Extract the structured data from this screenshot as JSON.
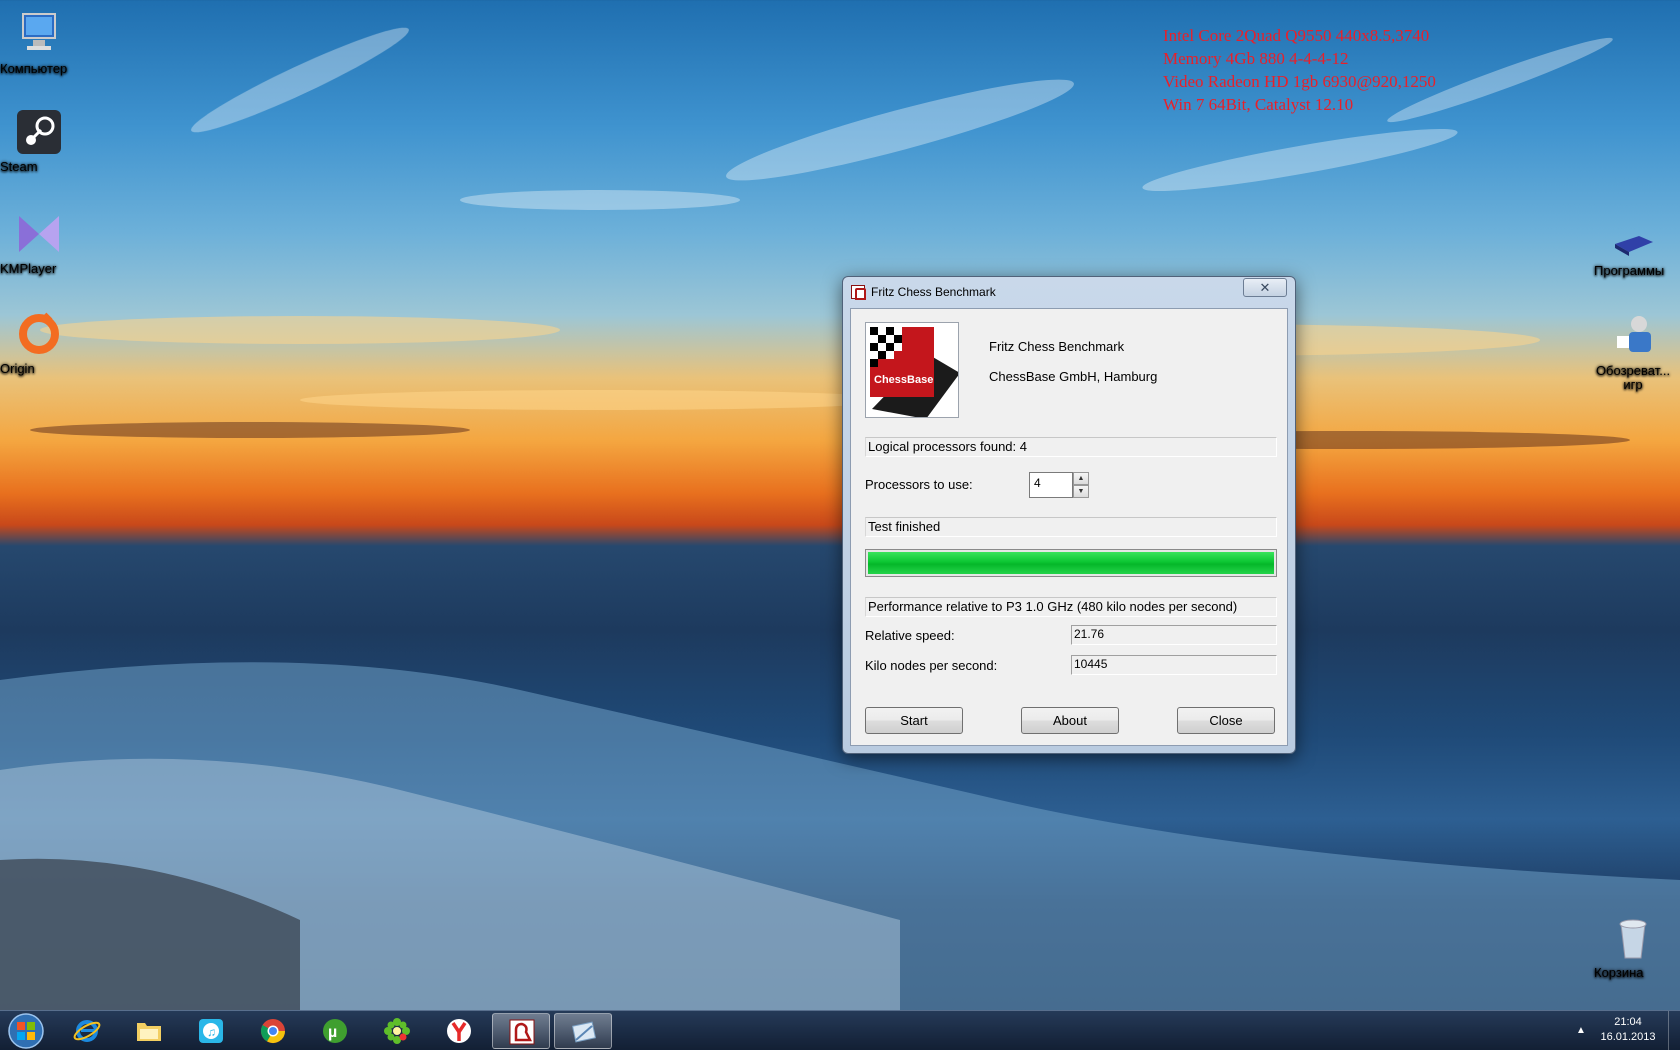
{
  "desktop": {
    "overlay_lines": [
      "Intel Core 2Quad Q9550 440x8.5,3740",
      "Memory 4Gb 880 4-4-4-12",
      "Video Radeon HD 1gb 6930@920,1250",
      "Win 7 64Bit, Catalyst 12.10"
    ],
    "overlay_color": "#e8202a",
    "icons_left": [
      {
        "label": "Компьютер",
        "icon": "computer-icon"
      },
      {
        "label": "Steam",
        "icon": "steam-icon"
      },
      {
        "label": "KMPlayer",
        "icon": "kmplayer-icon"
      },
      {
        "label": "Origin",
        "icon": "origin-icon"
      }
    ],
    "icons_right": [
      {
        "label": "Программы",
        "icon": "programs-icon"
      },
      {
        "label": "Обозреват... игр",
        "icon": "games-explorer-icon"
      },
      {
        "label": "Корзина",
        "icon": "recycle-bin-icon"
      }
    ]
  },
  "window": {
    "title": "Fritz Chess Benchmark",
    "close_glyph": "✕",
    "logo_text": "ChessBase",
    "app_name": "Fritz Chess Benchmark",
    "company": "ChessBase GmbH, Hamburg",
    "logical_processors": "Logical processors found: 4",
    "processors_to_use_label": "Processors to use:",
    "processors_to_use_value": "4",
    "status": "Test finished",
    "progress_fraction": 1.0,
    "progress_color": "#0cc633",
    "performance_caption": "Performance relative to P3 1.0 GHz (480 kilo nodes per second)",
    "relative_speed_label": "Relative speed:",
    "relative_speed_value": "21.76",
    "knps_label": "Kilo nodes per second:",
    "knps_value": "10445",
    "buttons": {
      "start": "Start",
      "about": "About",
      "close": "Close"
    }
  },
  "taskbar": {
    "items": [
      {
        "name": "internet-explorer",
        "icon": "ie-icon"
      },
      {
        "name": "windows-explorer",
        "icon": "folder-icon"
      },
      {
        "name": "itunes",
        "icon": "itunes-icon"
      },
      {
        "name": "chrome",
        "icon": "chrome-icon"
      },
      {
        "name": "utorrent",
        "icon": "utorrent-icon"
      },
      {
        "name": "icq",
        "icon": "icq-icon"
      },
      {
        "name": "yandex",
        "icon": "yandex-icon"
      },
      {
        "name": "fritz-chess-benchmark",
        "icon": "chessbase-icon"
      },
      {
        "name": "snipping-tool",
        "icon": "snipping-icon"
      }
    ],
    "clock_time": "21:04",
    "clock_date": "16.01.2013",
    "tray_arrow": "▲"
  }
}
